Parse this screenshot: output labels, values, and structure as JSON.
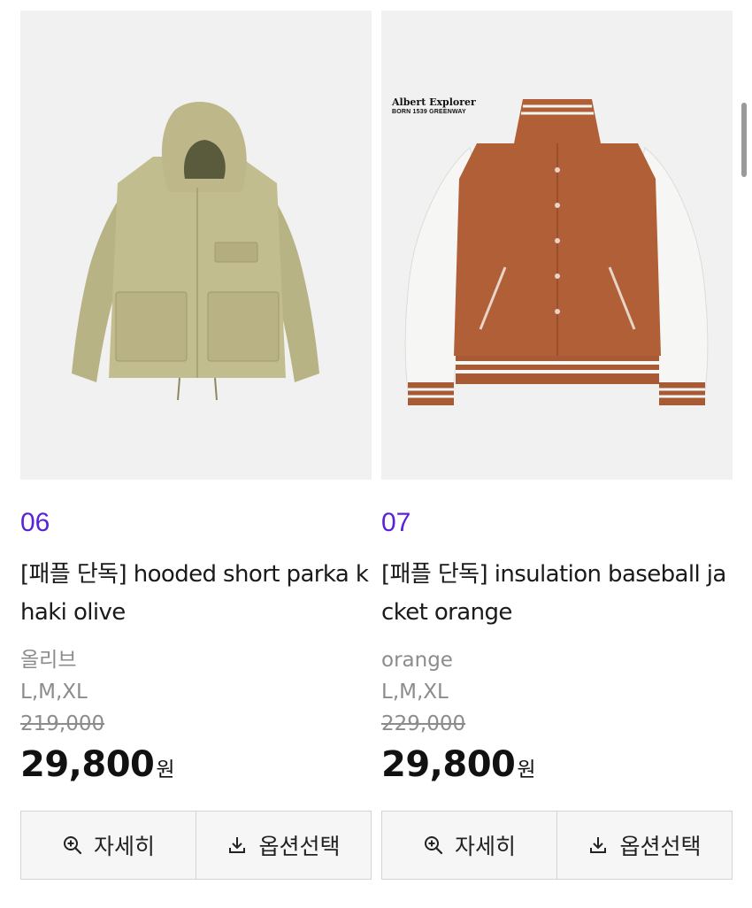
{
  "products": [
    {
      "number": "06",
      "name": "[패플 단독] hooded short parka khaki olive",
      "color": "올리브",
      "sizes": "L,M,XL",
      "original_price": "219,000",
      "sale_price": "29,800",
      "currency": "원",
      "image": "olive-hooded-parka",
      "buttons": {
        "detail": "자세히",
        "options": "옵션선택"
      }
    },
    {
      "number": "07",
      "name": "[패플 단독] insulation baseball jacket orange",
      "color": "orange",
      "sizes": "L,M,XL",
      "original_price": "229,000",
      "sale_price": "29,800",
      "currency": "원",
      "image": "orange-varsity-jacket",
      "brand_mark": {
        "name": "Albert Explorer",
        "subtitle": "BORN 1539 GREENWAY"
      },
      "buttons": {
        "detail": "자세히",
        "options": "옵션선택"
      }
    }
  ],
  "icons": {
    "detail": "zoom-in-icon",
    "options": "download-icon"
  },
  "colors": {
    "number": "#5b21d6",
    "text": "#1a1a1a",
    "muted": "#8c8c8c",
    "thumb_bg": "#f1f1f1"
  }
}
